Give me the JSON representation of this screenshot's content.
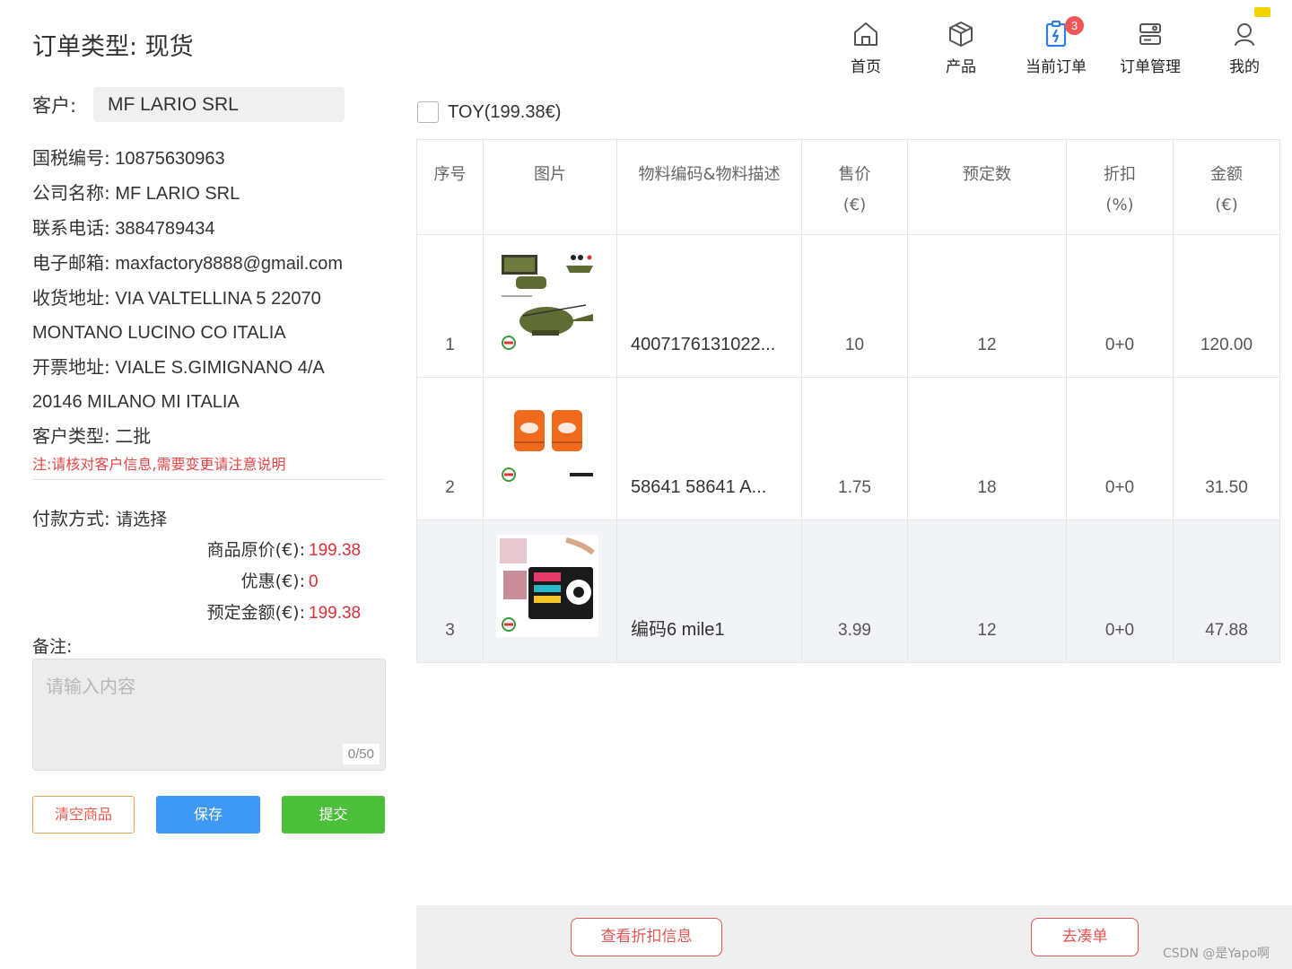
{
  "page": {
    "title": "订单类型: 现货"
  },
  "customer": {
    "label": "客户:",
    "value": "MF LARIO SRL",
    "info": [
      {
        "label": "国税编号:",
        "value": "10875630963"
      },
      {
        "label": "公司名称:",
        "value": "MF LARIO SRL"
      },
      {
        "label": "联系电话:",
        "value": "3884789434"
      },
      {
        "label": "电子邮箱:",
        "value": "maxfactory8888@gmail.com"
      },
      {
        "label": "收货地址:",
        "value": "VIA VALTELLINA 5 22070"
      },
      {
        "label": "",
        "value": "MONTANO LUCINO CO ITALIA"
      },
      {
        "label": "开票地址:",
        "value": "VIALE S.GIMIGNANO 4/A"
      },
      {
        "label": "",
        "value": "20146 MILANO MI ITALIA"
      },
      {
        "label": "客户类型:",
        "value": "二批"
      }
    ],
    "notice": "注:请核对客户信息,需要变更请注意说明"
  },
  "payment": {
    "label": "付款方式:",
    "value": "请选择"
  },
  "prices": {
    "original_label": "商品原价(€):",
    "original_value": "199.38",
    "discount_label": "优惠(€):",
    "discount_value": "0",
    "total_label": "预定金额(€):",
    "total_value": "199.38"
  },
  "remark": {
    "label": "备注:",
    "placeholder": "请输入内容",
    "counter": "0/50"
  },
  "actions": {
    "clear_label": "清空商品",
    "save_label": "保存",
    "submit_label": "提交"
  },
  "nav": {
    "items": [
      {
        "label": "首页",
        "icon": "home-icon"
      },
      {
        "label": "产品",
        "icon": "product-box-icon"
      },
      {
        "label": "当前订单",
        "icon": "current-order-icon",
        "badge": "3"
      },
      {
        "label": "订单管理",
        "icon": "order-management-icon"
      },
      {
        "label": "我的",
        "icon": "user-icon"
      }
    ]
  },
  "category": {
    "label": "TOY(199.38€)"
  },
  "table": {
    "headers": [
      {
        "line1": "序号",
        "line2": ""
      },
      {
        "line1": "图片",
        "line2": ""
      },
      {
        "line1": "物料编码&物料描述",
        "line2": ""
      },
      {
        "line1": "售价",
        "line2": "(€)"
      },
      {
        "line1": "预定数",
        "line2": ""
      },
      {
        "line1": "折扣",
        "line2": "(%)"
      },
      {
        "line1": "金额",
        "line2": "(€)"
      }
    ],
    "rows": [
      {
        "index": "1",
        "image": "toy-helicopter-image",
        "desc": "4007176131022...",
        "price": "10",
        "qty": "12",
        "discount": "0+0",
        "amount": "120.00"
      },
      {
        "index": "2",
        "image": "arm-floats-image",
        "desc": "58641 58641 A...",
        "price": "1.75",
        "qty": "18",
        "discount": "0+0",
        "amount": "31.50"
      },
      {
        "index": "3",
        "image": "craft-kit-image",
        "desc": "编码6 mile1",
        "price": "3.99",
        "qty": "12",
        "discount": "0+0",
        "amount": "47.88"
      }
    ]
  },
  "bottom": {
    "discount_button": "查看折扣信息",
    "combine_button": "去凑单"
  },
  "watermark": "CSDN @是Yapo啊",
  "colors": {
    "price_red": "#d9303a",
    "save_blue": "#3d98f3",
    "submit_green": "#4cbf3a",
    "badge_red": "#ee5656",
    "nav_icon_blue": "#2f7ee8"
  }
}
